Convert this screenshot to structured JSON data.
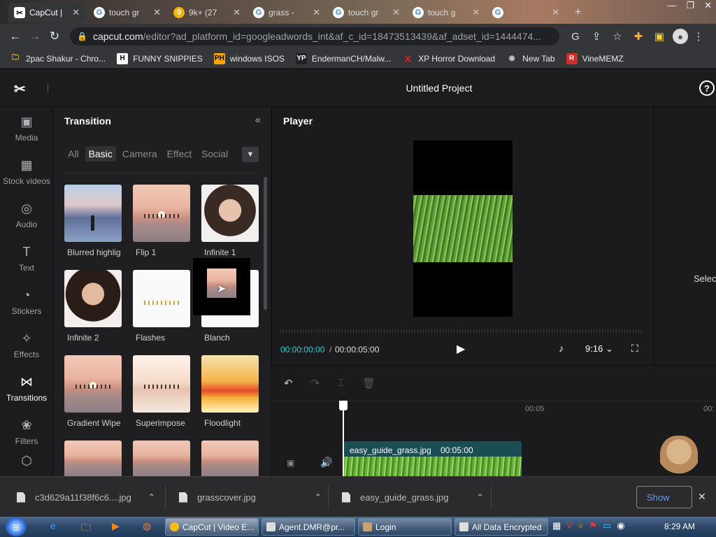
{
  "browser": {
    "tabs": [
      {
        "title": "CapCut |",
        "active": true
      },
      {
        "title": "touch gr"
      },
      {
        "title": "9k+ (27"
      },
      {
        "title": "grass -"
      },
      {
        "title": "touch gr"
      },
      {
        "title": "touch g"
      },
      {
        "title": ""
      }
    ],
    "new_tab": "+",
    "url_host": "capcut.com",
    "url_rest": "/editor?ad_platform_id=googleadwords_int&af_c_id=18473513439&af_adset_id=1444474...",
    "bookmarks": [
      {
        "label": "2pac Shakur - Chro...",
        "icon": "H"
      },
      {
        "label": "FUNNY SNIPPIES",
        "icon": "H"
      },
      {
        "label": "windows ISOS",
        "icon": "PH"
      },
      {
        "label": "EndermanCH/Malw...",
        "icon": "YP"
      },
      {
        "label": "XP Horror Download",
        "icon": "X"
      },
      {
        "label": "New Tab",
        "icon": "◉"
      },
      {
        "label": "VineMEMZ",
        "icon": "R"
      }
    ]
  },
  "app": {
    "project_title": "Untitled Project",
    "help": "?",
    "nav": [
      {
        "label": "Media",
        "icon": "▣"
      },
      {
        "label": "Stock videos",
        "icon": "▦"
      },
      {
        "label": "Audio",
        "icon": "◎"
      },
      {
        "label": "Text",
        "icon": "T"
      },
      {
        "label": "Stickers",
        "icon": "◔"
      },
      {
        "label": "Effects",
        "icon": "✧"
      },
      {
        "label": "Transitions",
        "icon": "⋈",
        "active": true
      },
      {
        "label": "Filters",
        "icon": "❀"
      }
    ],
    "panel": {
      "title": "Transition",
      "collapse": "«",
      "categories": [
        "All",
        "Basic",
        "Camera",
        "Effect",
        "Social"
      ],
      "active_category": "Basic",
      "items": [
        "Blurred highlig",
        "Flip 1",
        "Infinite 1",
        "Infinite 2",
        "Flashes",
        "Blanch",
        "Gradient Wipe",
        "Superimpose",
        "Floodlight",
        "",
        "",
        ""
      ]
    },
    "player": {
      "title": "Player",
      "time_current": "00:00:00:00",
      "time_separator": "/",
      "time_total": "00:00:05:00",
      "ratio": "9:16",
      "right_hint": "Selec"
    },
    "timeline": {
      "ticks": [
        "00:05",
        "00:"
      ],
      "clip_name": "easy_guide_grass.jpg",
      "clip_duration": "00:05:00"
    }
  },
  "downloads": {
    "items": [
      "c3d629a11f38f6c6....jpg",
      "grasscover.jpg",
      "easy_guide_grass.jpg"
    ],
    "show_all": "Show"
  },
  "taskbar": {
    "items": [
      {
        "label": "CapCut | Video E...",
        "active": true
      },
      {
        "label": "Agent.DMR@pr..."
      },
      {
        "label": "Login"
      },
      {
        "label": "All Data Encrypted"
      }
    ],
    "clock": "8:29 AM"
  },
  "colors": {
    "accent_time": "#2fd0d0",
    "clip_bg": "#1a4e54",
    "panel_bg": "#1f1f22"
  }
}
